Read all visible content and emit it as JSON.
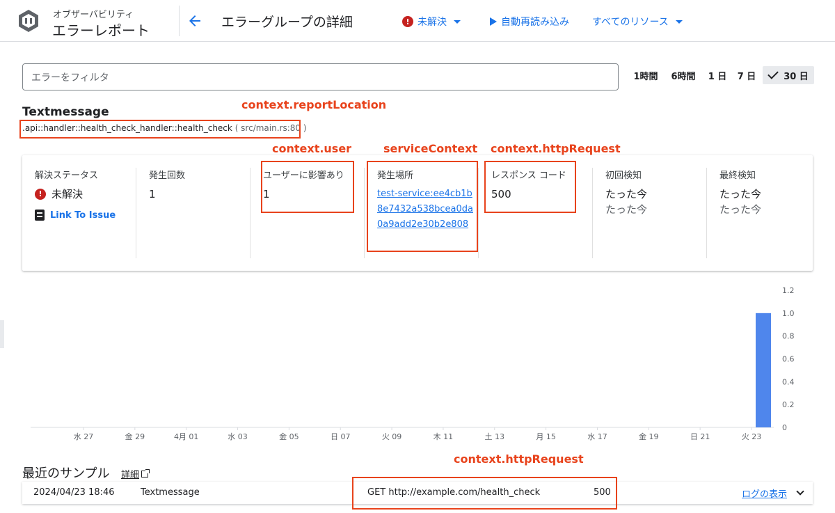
{
  "header": {
    "brand_sub": "オブザーバビリティ",
    "brand_title": "エラーレポート",
    "page_title": "エラーグループの詳細",
    "status_label": "未解決",
    "reload_label": "自動再読み込み",
    "resources_label": "すべてのリソース"
  },
  "filter": {
    "placeholder": "エラーをフィルタ"
  },
  "time_range": {
    "options": [
      "1時間",
      "6時間",
      "1 日",
      "7 日",
      "30 日"
    ],
    "selected": "30 日"
  },
  "error": {
    "name": "Textmessage",
    "location": ".api::handler::health_check_handler::health_check",
    "file": "( src/main.rs:80 )"
  },
  "annotations": {
    "report_location": "context.reportLocation",
    "user": "context.user",
    "service_context": "serviceContext",
    "http_request": "context.httpRequest",
    "http_request_2": "context.httpRequest"
  },
  "stats": {
    "resolution": {
      "label": "解決ステータス",
      "value": "未解決",
      "link": "Link To Issue"
    },
    "occurrences": {
      "label": "発生回数",
      "value": "1"
    },
    "users": {
      "label": "ユーザーに影響あり",
      "value": "1"
    },
    "seen_in": {
      "label": "発生場所",
      "value": "test-service:ee4cb1b8e7432a538bcea0da0a9add2e30b2e808"
    },
    "response_code": {
      "label": "レスポンス コード",
      "value": "500"
    },
    "first_seen": {
      "label": "初回検知",
      "value": "たった今",
      "sub": "たった今"
    },
    "last_seen": {
      "label": "最終検知",
      "value": "たった今",
      "sub": "たった今"
    }
  },
  "chart_data": {
    "type": "bar",
    "x_ticks": [
      "水 27",
      "金 29",
      "4月 01",
      "水 03",
      "金 05",
      "日 07",
      "火 09",
      "木 11",
      "土 13",
      "月 15",
      "水 17",
      "金 19",
      "日 21",
      "火 23"
    ],
    "bars": [
      {
        "x": "火 23",
        "value": 1.0
      }
    ],
    "ylim": [
      0,
      1.2
    ],
    "y_ticks": [
      0,
      0.2,
      0.4,
      0.6,
      0.8,
      1.0,
      1.2
    ],
    "color": "#4f86ec"
  },
  "samples": {
    "title": "最近のサンプル",
    "detail_link": "詳細",
    "rows": [
      {
        "time": "2024/04/23 18:46",
        "message": "Textmessage",
        "request": "GET http://example.com/health_check",
        "status": "500",
        "logs_link": "ログの表示"
      }
    ]
  }
}
